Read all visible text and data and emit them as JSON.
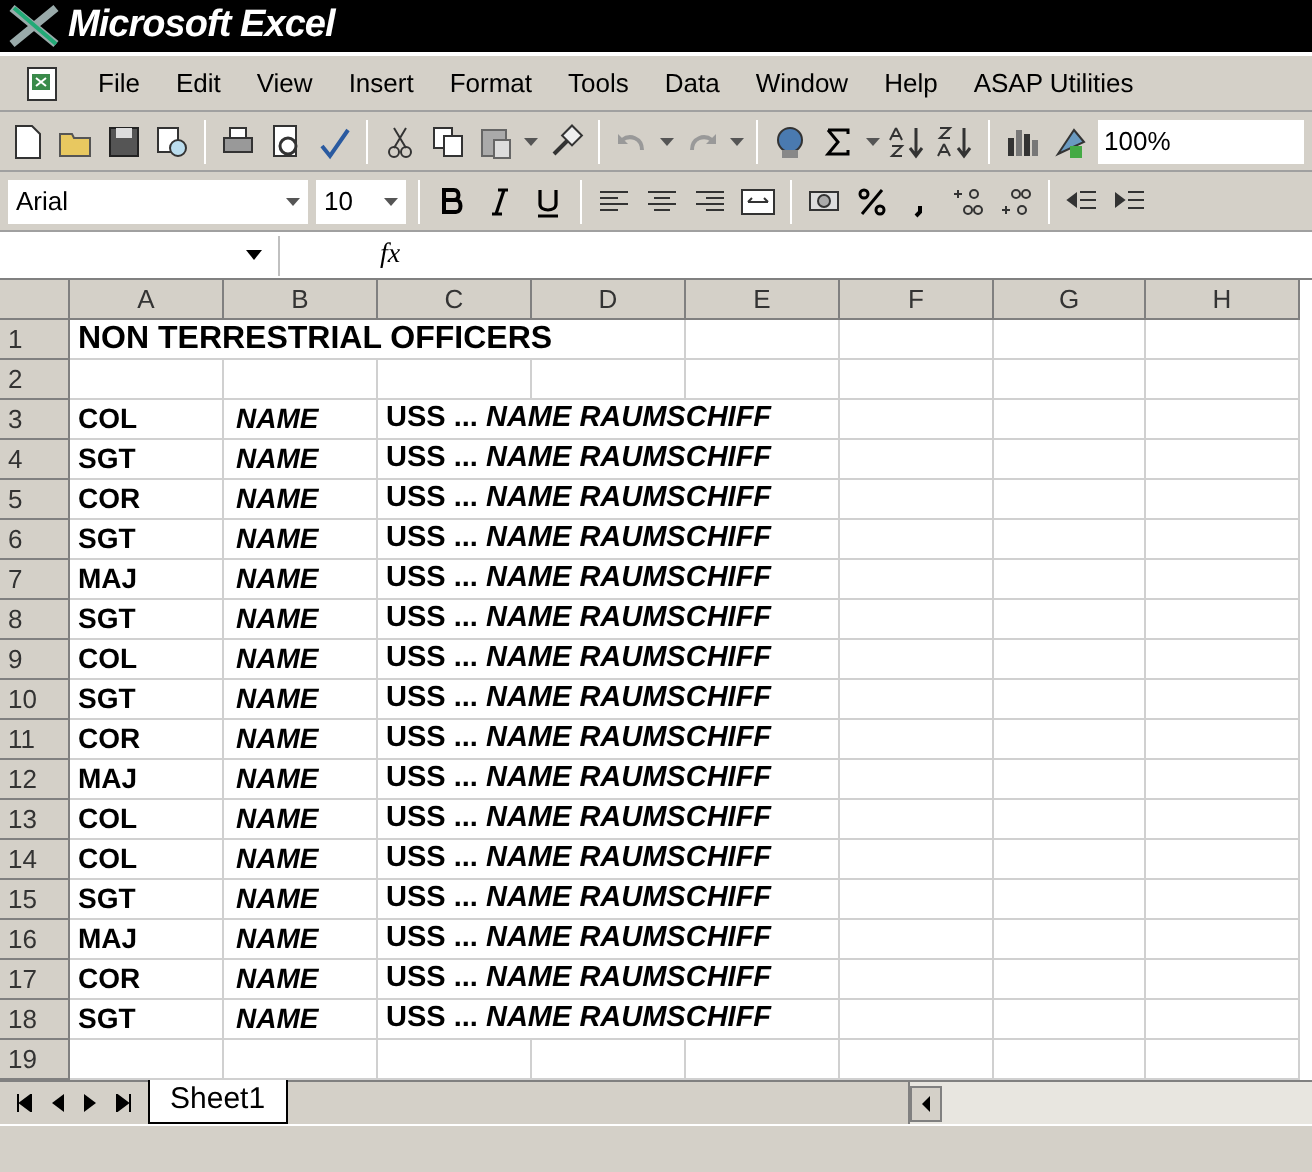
{
  "window": {
    "title": "Microsoft Excel"
  },
  "menu": [
    "File",
    "Edit",
    "View",
    "Insert",
    "Format",
    "Tools",
    "Data",
    "Window",
    "Help",
    "ASAP Utilities"
  ],
  "standard_toolbar": {
    "zoom": "100%"
  },
  "formatting_toolbar": {
    "font": "Arial",
    "size": "10"
  },
  "formula_bar": {
    "fx": "fx"
  },
  "sheet": {
    "columns": [
      "A",
      "B",
      "C",
      "D",
      "E",
      "F",
      "G",
      "H"
    ],
    "rows": [
      {
        "number": "1",
        "title": "NON TERRESTRIAL OFFICERS"
      },
      {
        "number": "2"
      },
      {
        "number": "3",
        "rank": "COL",
        "name": "NAME",
        "ship": "USS ... *NAME RAUMSCHIFF*"
      },
      {
        "number": "4",
        "rank": "SGT",
        "name": "NAME",
        "ship": "USS ... *NAME RAUMSCHIFF*"
      },
      {
        "number": "5",
        "rank": "COR",
        "name": "NAME",
        "ship": "USS ... *NAME RAUMSCHIFF*"
      },
      {
        "number": "6",
        "rank": "SGT",
        "name": "NAME",
        "ship": "USS ... *NAME RAUMSCHIFF*"
      },
      {
        "number": "7",
        "rank": "MAJ",
        "name": "NAME",
        "ship": "USS ... *NAME RAUMSCHIFF*"
      },
      {
        "number": "8",
        "rank": "SGT",
        "name": "NAME",
        "ship": "USS ... *NAME RAUMSCHIFF*"
      },
      {
        "number": "9",
        "rank": "COL",
        "name": "NAME",
        "ship": "USS ... *NAME RAUMSCHIFF*"
      },
      {
        "number": "10",
        "rank": "SGT",
        "name": "NAME",
        "ship": "USS ... *NAME RAUMSCHIFF*"
      },
      {
        "number": "11",
        "rank": "COR",
        "name": "NAME",
        "ship": "USS ... *NAME RAUMSCHIFF*"
      },
      {
        "number": "12",
        "rank": "MAJ",
        "name": "NAME",
        "ship": "USS ... *NAME RAUMSCHIFF*"
      },
      {
        "number": "13",
        "rank": "COL",
        "name": "NAME",
        "ship": "USS ... *NAME RAUMSCHIFF*"
      },
      {
        "number": "14",
        "rank": "COL",
        "name": "NAME",
        "ship": "USS ... *NAME RAUMSCHIFF*"
      },
      {
        "number": "15",
        "rank": "SGT",
        "name": "NAME",
        "ship": "USS ... *NAME RAUMSCHIFF*"
      },
      {
        "number": "16",
        "rank": "MAJ",
        "name": "NAME",
        "ship": "USS ... *NAME RAUMSCHIFF*"
      },
      {
        "number": "17",
        "rank": "COR",
        "name": "NAME",
        "ship": "USS ... *NAME RAUMSCHIFF*"
      },
      {
        "number": "18",
        "rank": "SGT",
        "name": "NAME",
        "ship": "USS ... *NAME RAUMSCHIFF*"
      },
      {
        "number": "19"
      }
    ]
  },
  "sheet_tabs": [
    {
      "label": "Sheet1",
      "selected": true
    }
  ]
}
